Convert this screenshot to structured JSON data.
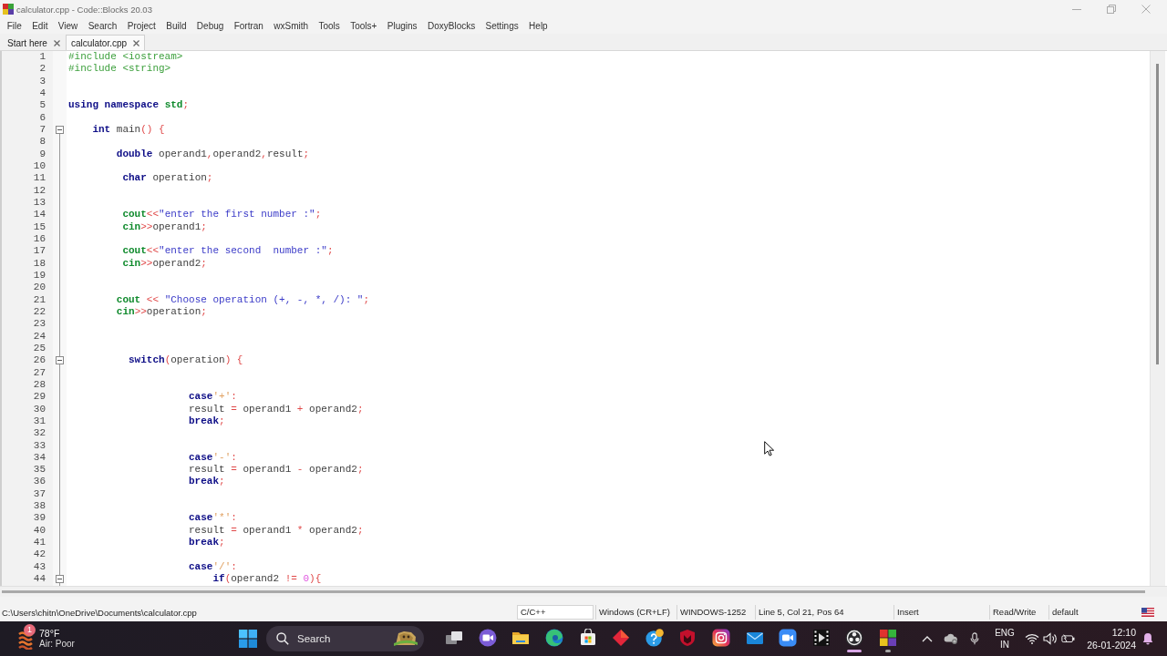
{
  "window": {
    "title": "calculator.cpp - Code::Blocks 20.03"
  },
  "menu": [
    "File",
    "Edit",
    "View",
    "Search",
    "Project",
    "Build",
    "Debug",
    "Fortran",
    "wxSmith",
    "Tools",
    "Tools+",
    "Plugins",
    "DoxyBlocks",
    "Settings",
    "Help"
  ],
  "editor": {
    "tabs": [
      {
        "label": "Start here",
        "selected": false
      },
      {
        "label": "calculator.cpp",
        "selected": true
      }
    ],
    "lines": [
      {
        "number": "1",
        "fold_start": false,
        "tokens": [
          {
            "kind": "preprocessor",
            "text": "#include <iostream>"
          }
        ]
      },
      {
        "number": "2",
        "fold_start": false,
        "tokens": [
          {
            "kind": "preprocessor",
            "text": "#include <string>"
          }
        ]
      },
      {
        "number": "3",
        "fold_start": false
      },
      {
        "number": "4",
        "fold_start": false
      },
      {
        "number": "5",
        "fold_start": false,
        "tokens": [
          {
            "kind": "keyword",
            "text": "using "
          },
          {
            "kind": "keyword",
            "text": "namespace "
          },
          {
            "kind": "builtin",
            "text": "std"
          },
          {
            "kind": "operator",
            "text": ";"
          }
        ]
      },
      {
        "number": "6",
        "fold_start": false
      },
      {
        "number": "7",
        "fold_start": true,
        "tokens": [
          {
            "kind": "keyword",
            "text": "    int "
          },
          {
            "kind": "identifier",
            "text": "main"
          },
          {
            "kind": "operator",
            "text": "() {"
          }
        ]
      },
      {
        "number": "8",
        "fold_start": false
      },
      {
        "number": "9",
        "fold_start": false,
        "tokens": [
          {
            "kind": "keyword",
            "text": "        double "
          },
          {
            "kind": "identifier",
            "text": "operand1"
          },
          {
            "kind": "operator",
            "text": ","
          },
          {
            "kind": "identifier",
            "text": "operand2"
          },
          {
            "kind": "operator",
            "text": ","
          },
          {
            "kind": "identifier",
            "text": "result"
          },
          {
            "kind": "operator",
            "text": ";"
          }
        ]
      },
      {
        "number": "10",
        "fold_start": false
      },
      {
        "number": "11",
        "fold_start": false,
        "tokens": [
          {
            "kind": "keyword",
            "text": "         char "
          },
          {
            "kind": "identifier",
            "text": "operation"
          },
          {
            "kind": "operator",
            "text": ";"
          }
        ]
      },
      {
        "number": "12",
        "fold_start": false
      },
      {
        "number": "13",
        "fold_start": false
      },
      {
        "number": "14",
        "fold_start": false,
        "tokens": [
          {
            "kind": "builtin",
            "text": "         cout"
          },
          {
            "kind": "operator",
            "text": "<<"
          },
          {
            "kind": "string",
            "text": "\"enter the first number :\""
          },
          {
            "kind": "operator",
            "text": ";"
          }
        ]
      },
      {
        "number": "15",
        "fold_start": false,
        "tokens": [
          {
            "kind": "builtin",
            "text": "         cin"
          },
          {
            "kind": "operator",
            "text": ">>"
          },
          {
            "kind": "identifier",
            "text": "operand1"
          },
          {
            "kind": "operator",
            "text": ";"
          }
        ]
      },
      {
        "number": "16",
        "fold_start": false
      },
      {
        "number": "17",
        "fold_start": false,
        "tokens": [
          {
            "kind": "builtin",
            "text": "         cout"
          },
          {
            "kind": "operator",
            "text": "<<"
          },
          {
            "kind": "string",
            "text": "\"enter the second  number :\""
          },
          {
            "kind": "operator",
            "text": ";"
          }
        ]
      },
      {
        "number": "18",
        "fold_start": false,
        "tokens": [
          {
            "kind": "builtin",
            "text": "         cin"
          },
          {
            "kind": "operator",
            "text": ">>"
          },
          {
            "kind": "identifier",
            "text": "operand2"
          },
          {
            "kind": "operator",
            "text": ";"
          }
        ]
      },
      {
        "number": "19",
        "fold_start": false
      },
      {
        "number": "20",
        "fold_start": false
      },
      {
        "number": "21",
        "fold_start": false,
        "tokens": [
          {
            "kind": "builtin",
            "text": "        cout"
          },
          {
            "kind": "operator",
            "text": " << "
          },
          {
            "kind": "string",
            "text": "\"Choose operation (+, -, *, /): \""
          },
          {
            "kind": "operator",
            "text": ";"
          }
        ]
      },
      {
        "number": "22",
        "fold_start": false,
        "tokens": [
          {
            "kind": "builtin",
            "text": "        cin"
          },
          {
            "kind": "operator",
            "text": ">>"
          },
          {
            "kind": "identifier",
            "text": "operation"
          },
          {
            "kind": "operator",
            "text": ";"
          }
        ]
      },
      {
        "number": "23",
        "fold_start": false
      },
      {
        "number": "24",
        "fold_start": false
      },
      {
        "number": "25",
        "fold_start": false
      },
      {
        "number": "26",
        "fold_start": true,
        "tokens": [
          {
            "kind": "keyword",
            "text": "          switch"
          },
          {
            "kind": "operator",
            "text": "("
          },
          {
            "kind": "identifier",
            "text": "operation"
          },
          {
            "kind": "operator",
            "text": ") {"
          }
        ]
      },
      {
        "number": "27",
        "fold_start": false
      },
      {
        "number": "28",
        "fold_start": false
      },
      {
        "number": "29",
        "fold_start": false,
        "tokens": [
          {
            "kind": "keyword",
            "text": "                    case"
          },
          {
            "kind": "char",
            "text": "'+'"
          },
          {
            "kind": "operator",
            "text": ":"
          }
        ]
      },
      {
        "number": "30",
        "fold_start": false,
        "tokens": [
          {
            "kind": "identifier",
            "text": "                    result "
          },
          {
            "kind": "operator",
            "text": "= "
          },
          {
            "kind": "identifier",
            "text": "operand1 "
          },
          {
            "kind": "operator",
            "text": "+ "
          },
          {
            "kind": "identifier",
            "text": "operand2"
          },
          {
            "kind": "operator",
            "text": ";"
          }
        ]
      },
      {
        "number": "31",
        "fold_start": false,
        "tokens": [
          {
            "kind": "keyword",
            "text": "                    break"
          },
          {
            "kind": "operator",
            "text": ";"
          }
        ]
      },
      {
        "number": "32",
        "fold_start": false
      },
      {
        "number": "33",
        "fold_start": false
      },
      {
        "number": "34",
        "fold_start": false,
        "tokens": [
          {
            "kind": "keyword",
            "text": "                    case"
          },
          {
            "kind": "char",
            "text": "'-'"
          },
          {
            "kind": "operator",
            "text": ":"
          }
        ]
      },
      {
        "number": "35",
        "fold_start": false,
        "tokens": [
          {
            "kind": "identifier",
            "text": "                    result "
          },
          {
            "kind": "operator",
            "text": "= "
          },
          {
            "kind": "identifier",
            "text": "operand1 "
          },
          {
            "kind": "operator",
            "text": "- "
          },
          {
            "kind": "identifier",
            "text": "operand2"
          },
          {
            "kind": "operator",
            "text": ";"
          }
        ]
      },
      {
        "number": "36",
        "fold_start": false,
        "tokens": [
          {
            "kind": "keyword",
            "text": "                    break"
          },
          {
            "kind": "operator",
            "text": ";"
          }
        ]
      },
      {
        "number": "37",
        "fold_start": false
      },
      {
        "number": "38",
        "fold_start": false
      },
      {
        "number": "39",
        "fold_start": false,
        "tokens": [
          {
            "kind": "keyword",
            "text": "                    case"
          },
          {
            "kind": "char",
            "text": "'*'"
          },
          {
            "kind": "operator",
            "text": ":"
          }
        ]
      },
      {
        "number": "40",
        "fold_start": false,
        "tokens": [
          {
            "kind": "identifier",
            "text": "                    result "
          },
          {
            "kind": "operator",
            "text": "= "
          },
          {
            "kind": "identifier",
            "text": "operand1 "
          },
          {
            "kind": "operator",
            "text": "* "
          },
          {
            "kind": "identifier",
            "text": "operand2"
          },
          {
            "kind": "operator",
            "text": ";"
          }
        ]
      },
      {
        "number": "41",
        "fold_start": false,
        "tokens": [
          {
            "kind": "keyword",
            "text": "                    break"
          },
          {
            "kind": "operator",
            "text": ";"
          }
        ]
      },
      {
        "number": "42",
        "fold_start": false
      },
      {
        "number": "43",
        "fold_start": false,
        "tokens": [
          {
            "kind": "keyword",
            "text": "                    case"
          },
          {
            "kind": "char",
            "text": "'/'"
          },
          {
            "kind": "operator",
            "text": ":"
          }
        ]
      },
      {
        "number": "44",
        "fold_start": true,
        "tokens": [
          {
            "kind": "keyword",
            "text": "                        if"
          },
          {
            "kind": "operator",
            "text": "("
          },
          {
            "kind": "identifier",
            "text": "operand2 "
          },
          {
            "kind": "operator",
            "text": "!= "
          },
          {
            "kind": "number",
            "text": "0"
          },
          {
            "kind": "operator",
            "text": "){"
          }
        ]
      }
    ]
  },
  "status_bar": {
    "path": "C:\\Users\\chitn\\OneDrive\\Documents\\calculator.cpp",
    "fields": [
      {
        "kind": "selector",
        "text": "C/C++"
      },
      {
        "kind": "label",
        "text": "Windows (CR+LF)"
      },
      {
        "kind": "label",
        "text": "WINDOWS-1252"
      },
      {
        "kind": "label",
        "text": "Line 5, Col 21, Pos 64"
      },
      {
        "kind": "label",
        "text": "Insert"
      },
      {
        "kind": "label",
        "text": "Read/Write"
      },
      {
        "kind": "label",
        "text": "default"
      }
    ]
  },
  "taskbar": {
    "weather": {
      "badge": "1",
      "temperature": "78°F",
      "condition": "Air: Poor"
    },
    "search": {
      "label": "Search"
    },
    "apps": [
      {
        "kind": "taskview",
        "running": false,
        "selected": false
      },
      {
        "kind": "meet",
        "running": false,
        "selected": false
      },
      {
        "kind": "folder",
        "running": false,
        "selected": false
      },
      {
        "kind": "browser",
        "running": false,
        "selected": false
      },
      {
        "kind": "store",
        "running": false,
        "selected": false
      },
      {
        "kind": "diamond",
        "running": false,
        "selected": false
      },
      {
        "kind": "help",
        "running": false,
        "selected": false
      },
      {
        "kind": "shield",
        "running": false,
        "selected": false
      },
      {
        "kind": "camera",
        "running": false,
        "selected": false
      },
      {
        "kind": "mail",
        "running": false,
        "selected": false
      },
      {
        "kind": "video",
        "running": false,
        "selected": false
      },
      {
        "kind": "film",
        "running": false,
        "selected": false
      },
      {
        "kind": "ring",
        "running": true,
        "selected": true
      },
      {
        "kind": "tiles",
        "running": true,
        "selected": false
      }
    ],
    "language": [
      "ENG",
      "IN"
    ],
    "time": "12:10",
    "date": "26-01-2024"
  }
}
